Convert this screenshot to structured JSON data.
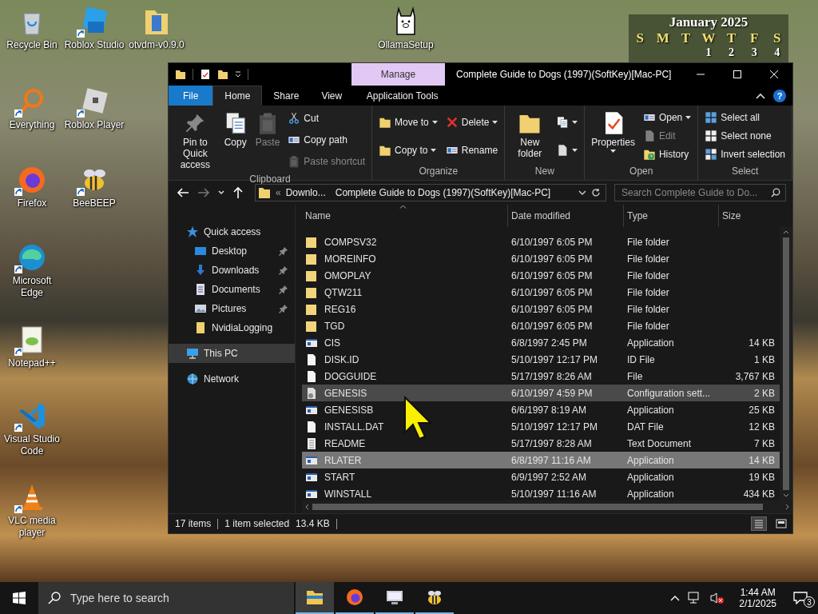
{
  "desktop_icons": [
    {
      "label": "Recycle Bin",
      "kind": "bin",
      "shortcut": false
    },
    {
      "label": "Roblox Studio",
      "kind": "studio",
      "shortcut": true
    },
    {
      "label": "otvdm-v0.9.0",
      "kind": "folder",
      "shortcut": false
    },
    {
      "label": "OllamaSetup",
      "kind": "llama",
      "shortcut": false
    },
    {
      "label": "Everything",
      "kind": "search",
      "shortcut": true
    },
    {
      "label": "Roblox Player",
      "kind": "player",
      "shortcut": true
    },
    {
      "label": "Firefox",
      "kind": "firefox",
      "shortcut": true
    },
    {
      "label": "BeeBEEP",
      "kind": "bee",
      "shortcut": true
    },
    {
      "label": "Microsoft Edge",
      "kind": "edge",
      "shortcut": true
    },
    {
      "label": "Notepad++",
      "kind": "notepad",
      "shortcut": true
    },
    {
      "label": "Visual Studio Code",
      "kind": "code",
      "shortcut": true
    },
    {
      "label": "VLC media player",
      "kind": "cone",
      "shortcut": true
    }
  ],
  "calendar": {
    "title": "January 2025",
    "weekdays": [
      "S",
      "M",
      "T",
      "W",
      "T",
      "F",
      "S"
    ],
    "first_week": [
      "1",
      "2",
      "3",
      "4"
    ]
  },
  "window": {
    "title": "Complete Guide to Dogs (1997)(SoftKey)[Mac-PC]",
    "context_tab": "Manage",
    "help": "?"
  },
  "ribbon_tabs": [
    {
      "label": "File",
      "kind": "file",
      "selected": false
    },
    {
      "label": "Home",
      "kind": "tab",
      "selected": true
    },
    {
      "label": "Share",
      "kind": "tab",
      "selected": false
    },
    {
      "label": "View",
      "kind": "tab",
      "selected": false
    },
    {
      "label": "Application Tools",
      "kind": "context",
      "selected": false
    }
  ],
  "ribbon_groups": [
    {
      "label": "Clipboard",
      "columns": [
        {
          "items": [
            {
              "label": "Pin to Quick access",
              "kind": "large",
              "dropdown": false,
              "disabled": false
            }
          ]
        },
        {
          "items": [
            {
              "label": "Copy",
              "kind": "large",
              "dropdown": false,
              "disabled": false
            }
          ]
        },
        {
          "items": [
            {
              "label": "Paste",
              "kind": "large",
              "dropdown": false,
              "disabled": true
            }
          ]
        },
        {
          "items": [
            {
              "label": "Cut",
              "kind": "small",
              "dropdown": false,
              "disabled": false
            },
            {
              "label": "Copy path",
              "kind": "small",
              "dropdown": false,
              "disabled": false
            },
            {
              "label": "Paste shortcut",
              "kind": "small",
              "dropdown": false,
              "disabled": true
            }
          ]
        }
      ]
    },
    {
      "label": "Organize",
      "columns": [
        {
          "items": [
            {
              "label": "Move to",
              "kind": "small",
              "dropdown": true,
              "disabled": false
            },
            {
              "label": "Copy to",
              "kind": "small",
              "dropdown": true,
              "disabled": false
            }
          ]
        },
        {
          "items": [
            {
              "label": "Delete",
              "kind": "small",
              "dropdown": true,
              "disabled": false
            },
            {
              "label": "Rename",
              "kind": "small",
              "dropdown": false,
              "disabled": false
            }
          ]
        }
      ]
    },
    {
      "label": "New",
      "columns": [
        {
          "items": [
            {
              "label": "New folder",
              "kind": "large",
              "dropdown": false,
              "disabled": false
            }
          ]
        },
        {
          "items": [
            {
              "kind": "small",
              "dropdown": true,
              "disabled": false
            },
            {
              "kind": "small",
              "dropdown": true,
              "disabled": false
            }
          ]
        }
      ]
    },
    {
      "label": "Open",
      "columns": [
        {
          "items": [
            {
              "label": "Properties",
              "kind": "large",
              "dropdown": true,
              "disabled": false
            }
          ]
        },
        {
          "items": [
            {
              "label": "Open",
              "kind": "small",
              "dropdown": true,
              "disabled": false
            },
            {
              "label": "Edit",
              "kind": "small",
              "dropdown": false,
              "disabled": true
            },
            {
              "label": "History",
              "kind": "small",
              "dropdown": false,
              "disabled": false
            }
          ]
        }
      ]
    },
    {
      "label": "Select",
      "columns": [
        {
          "items": [
            {
              "label": "Select all",
              "kind": "small",
              "dropdown": false,
              "disabled": false
            },
            {
              "label": "Select none",
              "kind": "small",
              "dropdown": false,
              "disabled": false
            },
            {
              "label": "Invert selection",
              "kind": "small",
              "dropdown": false,
              "disabled": false
            }
          ]
        }
      ]
    }
  ],
  "address": {
    "overflow": "«",
    "crumbs": [
      "Downlo...",
      "Complete Guide to Dogs (1997)(SoftKey)[Mac-PC]"
    ]
  },
  "search": {
    "placeholder": "Search Complete Guide to Do..."
  },
  "nav": [
    {
      "label": "Quick access",
      "kind": "star",
      "selected": false,
      "children": [
        {
          "label": "Desktop",
          "kind": "desktop",
          "pinned": true,
          "selected": false
        },
        {
          "label": "Downloads",
          "kind": "downloads",
          "pinned": true,
          "selected": false
        },
        {
          "label": "Documents",
          "kind": "documents",
          "pinned": true,
          "selected": false
        },
        {
          "label": "Pictures",
          "kind": "pictures",
          "pinned": true,
          "selected": false
        },
        {
          "label": "NvidiaLogging",
          "kind": "folder",
          "pinned": false,
          "selected": false
        }
      ]
    },
    {
      "label": "This PC",
      "kind": "pc",
      "selected": true
    },
    {
      "label": "Network",
      "kind": "network",
      "selected": false
    }
  ],
  "columns": [
    {
      "label": "Name",
      "sorted": true
    },
    {
      "label": "Date modified",
      "sorted": false
    },
    {
      "label": "Type",
      "sorted": false
    },
    {
      "label": "Size",
      "sorted": false
    }
  ],
  "rows": [
    {
      "name": "COMPSV32",
      "date": "6/10/1997 6:05 PM",
      "type": "File folder",
      "kind": "folder",
      "selected": false,
      "hovered": false
    },
    {
      "name": "MOREINFO",
      "date": "6/10/1997 6:05 PM",
      "type": "File folder",
      "kind": "folder",
      "selected": false,
      "hovered": false
    },
    {
      "name": "OMOPLAY",
      "date": "6/10/1997 6:05 PM",
      "type": "File folder",
      "kind": "folder",
      "selected": false,
      "hovered": false
    },
    {
      "name": "QTW211",
      "date": "6/10/1997 6:05 PM",
      "type": "File folder",
      "kind": "folder",
      "selected": false,
      "hovered": false
    },
    {
      "name": "REG16",
      "date": "6/10/1997 6:05 PM",
      "type": "File folder",
      "kind": "folder",
      "selected": false,
      "hovered": false
    },
    {
      "name": "TGD",
      "date": "6/10/1997 6:05 PM",
      "type": "File folder",
      "kind": "folder",
      "selected": false,
      "hovered": false
    },
    {
      "name": "CIS",
      "date": "6/8/1997 2:45 PM",
      "type": "Application",
      "size": "14 KB",
      "kind": "app",
      "selected": false,
      "hovered": false
    },
    {
      "name": "DISK.ID",
      "date": "5/10/1997 12:17 PM",
      "type": "ID File",
      "size": "1 KB",
      "kind": "file",
      "selected": false,
      "hovered": false
    },
    {
      "name": "DOGGUIDE",
      "date": "5/17/1997 8:26 AM",
      "type": "File",
      "size": "3,767 KB",
      "kind": "file",
      "selected": false,
      "hovered": false
    },
    {
      "name": "GENESIS",
      "date": "6/10/1997 4:59 PM",
      "type": "Configuration sett...",
      "size": "2 KB",
      "kind": "config",
      "selected": false,
      "hovered": true
    },
    {
      "name": "GENESISB",
      "date": "6/6/1997 8:19 AM",
      "type": "Application",
      "size": "25 KB",
      "kind": "app",
      "selected": false,
      "hovered": false
    },
    {
      "name": "INSTALL.DAT",
      "date": "5/10/1997 12:17 PM",
      "type": "DAT File",
      "size": "12 KB",
      "kind": "file",
      "selected": false,
      "hovered": false
    },
    {
      "name": "README",
      "date": "5/17/1997 8:28 AM",
      "type": "Text Document",
      "size": "7 KB",
      "kind": "text",
      "selected": false,
      "hovered": false
    },
    {
      "name": "RLATER",
      "date": "6/8/1997 11:16 AM",
      "type": "Application",
      "size": "14 KB",
      "kind": "app",
      "selected": true,
      "hovered": false
    },
    {
      "name": "START",
      "date": "6/9/1997 2:52 AM",
      "type": "Application",
      "size": "19 KB",
      "kind": "app",
      "selected": false,
      "hovered": false
    },
    {
      "name": "WINSTALL",
      "date": "5/10/1997 11:16 AM",
      "type": "Application",
      "size": "434 KB",
      "kind": "app",
      "selected": false,
      "hovered": false
    }
  ],
  "status_bar": {
    "count": "17 items",
    "selection": "1 item selected",
    "size": "13.4 KB",
    "views": [
      {
        "kind": "details",
        "selected": true
      },
      {
        "kind": "tiles",
        "selected": false
      }
    ]
  },
  "taskbar": {
    "search_placeholder": "Type here to search",
    "apps": [
      {
        "kind": "explorer",
        "active": true,
        "running": true
      },
      {
        "kind": "firefox",
        "active": false,
        "running": true
      },
      {
        "kind": "monitor",
        "active": false,
        "running": true
      },
      {
        "kind": "bee",
        "active": false,
        "running": true
      }
    ],
    "time": "1:44 AM",
    "date": "2/1/2025",
    "notifications": "3"
  }
}
